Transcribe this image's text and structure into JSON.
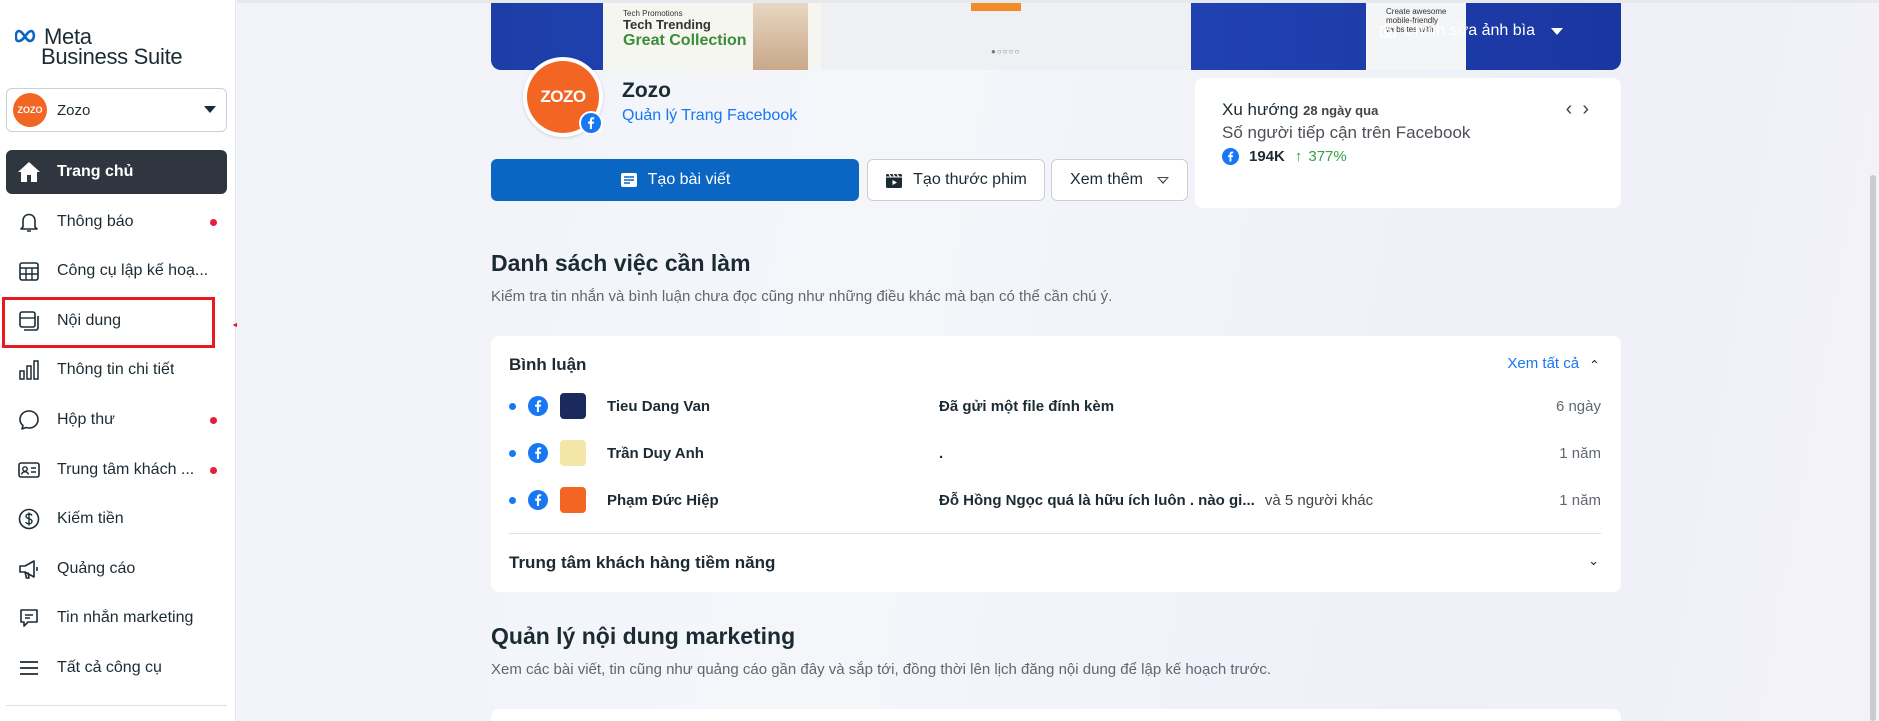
{
  "brand": {
    "meta": "Meta",
    "suite": "Business Suite"
  },
  "account": {
    "avatar_text": "ZOZO",
    "name": "Zozo"
  },
  "sidebar": {
    "items": [
      {
        "label": "Trang chủ",
        "icon": "home-icon",
        "active": true,
        "dot": false
      },
      {
        "label": "Thông báo",
        "icon": "bell-icon",
        "dot": true
      },
      {
        "label": "Công cụ lập kế hoạ...",
        "icon": "calendar-icon",
        "dot": false
      },
      {
        "label": "Nội dung",
        "icon": "content-icon",
        "dot": false,
        "highlighted": true
      },
      {
        "label": "Thông tin chi tiết",
        "icon": "bar-chart-icon",
        "dot": false
      },
      {
        "label": "Hộp thư",
        "icon": "chat-bubble-icon",
        "dot": true
      },
      {
        "label": "Trung tâm khách ...",
        "icon": "contact-card-icon",
        "dot": true
      },
      {
        "label": "Kiếm tiền",
        "icon": "dollar-icon",
        "dot": false
      },
      {
        "label": "Quảng cáo",
        "icon": "megaphone-icon",
        "dot": false
      },
      {
        "label": "Tin nhắn marketing",
        "icon": "message-marketing-icon",
        "dot": false
      },
      {
        "label": "Tất cả công cụ",
        "icon": "menu-icon",
        "dot": false
      }
    ]
  },
  "cover": {
    "card_label_small": "Tech Promotions",
    "card_label": "Tech Trending",
    "card_label_big": "Great Collection",
    "promo_text": "Create awesome mobile-friendly websites with",
    "edit_label": "Chỉnh sửa ảnh bìa"
  },
  "page": {
    "avatar_text": "ZOZO",
    "name": "Zozo",
    "subtitle": "Quản lý Trang Facebook"
  },
  "actions": {
    "create_post": "Tạo bài viết",
    "create_reel": "Tạo thước phim",
    "see_more": "Xem thêm"
  },
  "trend": {
    "title": "Xu hướng",
    "period": "28 ngày qua",
    "subtitle": "Số người tiếp cận trên Facebook",
    "value": "194K",
    "change": "377%"
  },
  "todo": {
    "title": "Danh sách việc cần làm",
    "description": "Kiểm tra tin nhắn và bình luận chưa đọc cũng như những điều khác mà bạn có thể cần chú ý.",
    "comments": {
      "title": "Bình luận",
      "see_all": "Xem tất cả",
      "rows": [
        {
          "name": "Tieu Dang Van",
          "message": "Đã gửi một file đính kèm",
          "extra": "",
          "time": "6 ngày",
          "thumb_color": "#1b2a5c"
        },
        {
          "name": "Trần Duy Anh",
          "message": ".",
          "extra": "",
          "time": "1 năm",
          "thumb_color": "#f3e6a6"
        },
        {
          "name": "Phạm Đức Hiệp",
          "message": "Đỗ Hồng Ngọc quá là hữu ích luôn . nào gi...",
          "extra": "và 5 người khác",
          "time": "1 năm",
          "thumb_color": "#f26522"
        }
      ]
    },
    "leads": {
      "title": "Trung tâm khách hàng tiềm năng"
    }
  },
  "marketing": {
    "title": "Quản lý nội dung marketing",
    "description": "Xem các bài viết, tin cũng như quảng cáo gần đây và sắp tới, đồng thời lên lịch đăng nội dung để lập kế hoạch trước."
  },
  "colors": {
    "primary": "#0a66c2",
    "sidebar_active": "#2f3640",
    "notification_dot": "#e41e3f",
    "highlight": "#e8191f",
    "link": "#1877f2"
  }
}
